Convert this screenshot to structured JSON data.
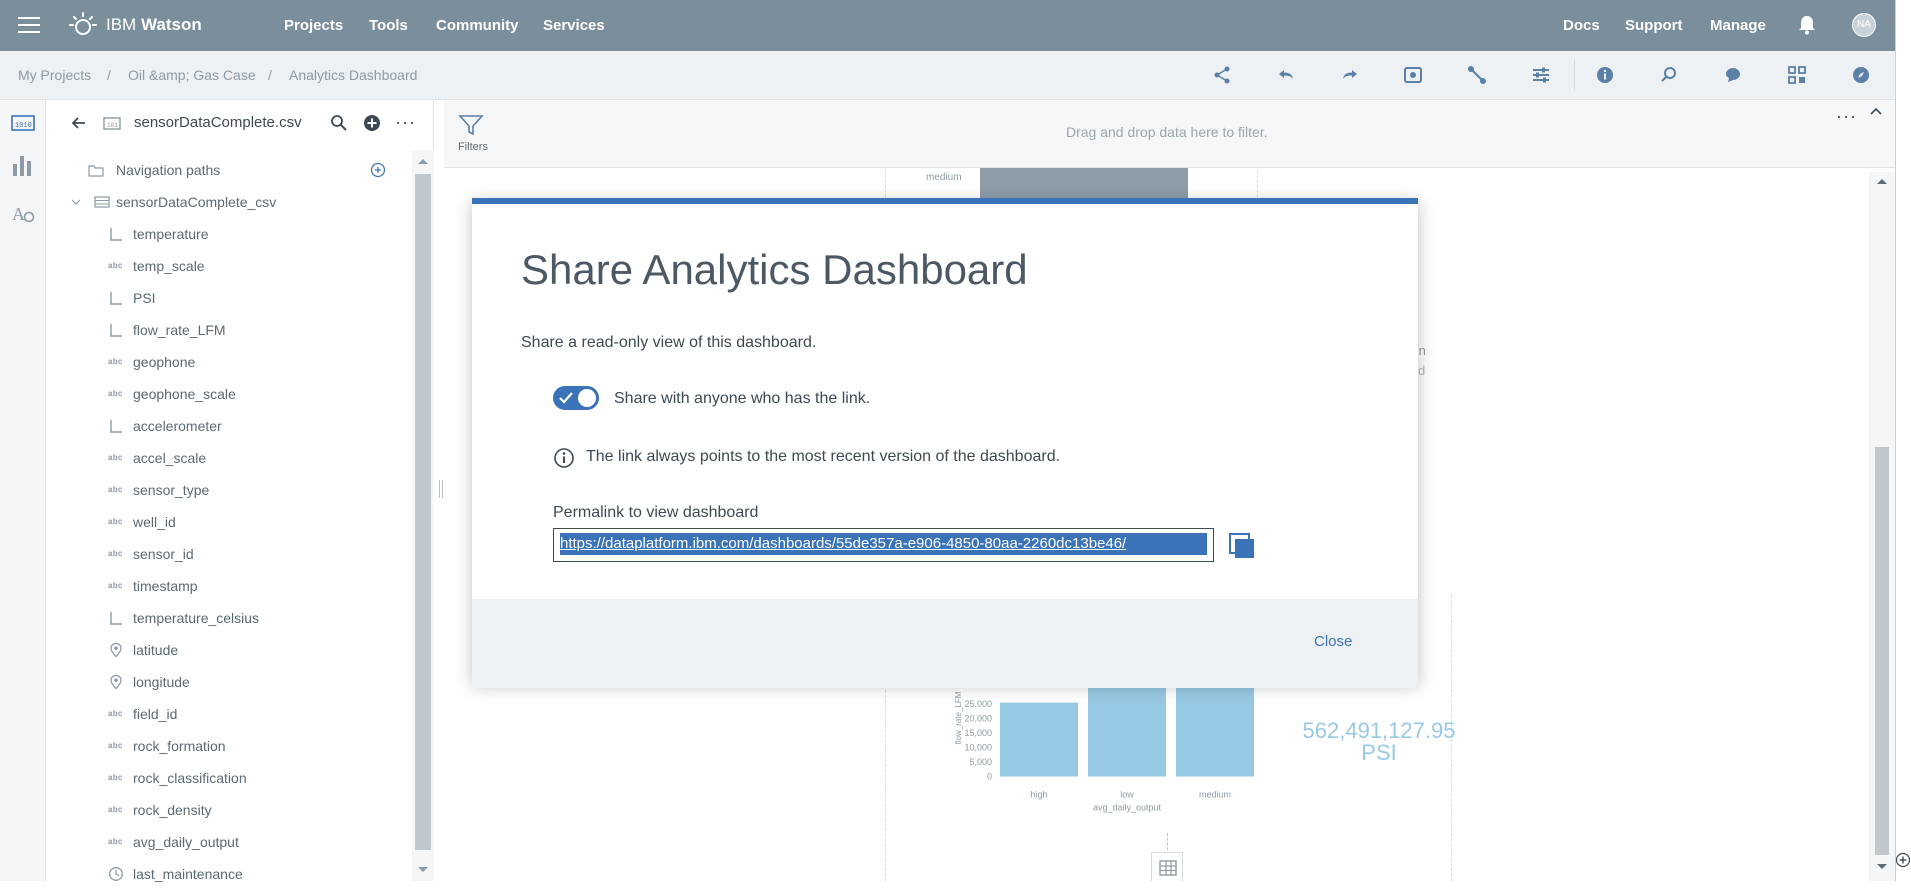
{
  "topbar": {
    "brand_prefix": "IBM",
    "brand_name": "Watson",
    "nav": [
      "Projects",
      "Tools",
      "Community",
      "Services"
    ],
    "right": [
      "Docs",
      "Support",
      "Manage"
    ],
    "avatar": "NA"
  },
  "breadcrumb": [
    "My Projects",
    "Oil &amp; Gas Case",
    "Analytics Dashboard"
  ],
  "panel": {
    "title": "sensorDataComplete.csv",
    "nav_paths": "Navigation paths",
    "table": "sensorDataComplete_csv",
    "fields": [
      {
        "name": "temperature",
        "type": "measure"
      },
      {
        "name": "temp_scale",
        "type": "abc"
      },
      {
        "name": "PSI",
        "type": "measure"
      },
      {
        "name": "flow_rate_LFM",
        "type": "measure"
      },
      {
        "name": "geophone",
        "type": "abc"
      },
      {
        "name": "geophone_scale",
        "type": "abc"
      },
      {
        "name": "accelerometer",
        "type": "measure"
      },
      {
        "name": "accel_scale",
        "type": "abc"
      },
      {
        "name": "sensor_type",
        "type": "abc"
      },
      {
        "name": "well_id",
        "type": "abc"
      },
      {
        "name": "sensor_id",
        "type": "abc"
      },
      {
        "name": "timestamp",
        "type": "abc"
      },
      {
        "name": "temperature_celsius",
        "type": "measure"
      },
      {
        "name": "latitude",
        "type": "geo"
      },
      {
        "name": "longitude",
        "type": "geo"
      },
      {
        "name": "field_id",
        "type": "abc"
      },
      {
        "name": "rock_formation",
        "type": "abc"
      },
      {
        "name": "rock_classification",
        "type": "abc"
      },
      {
        "name": "rock_density",
        "type": "abc"
      },
      {
        "name": "avg_daily_output",
        "type": "abc"
      },
      {
        "name": "last_maintenance",
        "type": "time"
      }
    ]
  },
  "canvas": {
    "filters_label": "Filters",
    "drop_hint": "Drag and drop data here to filter.",
    "bg_label_medium": "medium",
    "bg_text_1": "ition",
    "bg_text_2": "d",
    "kpi_value": "562,491,127.95",
    "kpi_unit": "PSI"
  },
  "chart_data": {
    "type": "bar",
    "categories": [
      "high",
      "low",
      "medium"
    ],
    "xlabel": "avg_daily_output",
    "ylabel": "flow_rate_LFM",
    "yticks": [
      "25,000",
      "20,000",
      "15,000",
      "10,000",
      "5,000",
      "0"
    ],
    "values": [
      25500,
      31000,
      31000
    ],
    "ylim": [
      0,
      25000
    ]
  },
  "modal": {
    "title": "Share Analytics Dashboard",
    "subtitle": "Share a read-only view of this dashboard.",
    "toggle_label": "Share with anyone who has the link.",
    "toggle_on": true,
    "info": "The link always points to the most recent version of the dashboard.",
    "permalink_label": "Permalink to view dashboard",
    "permalink": "https://dataplatform.ibm.com/dashboards/55de357a-e906-4850-80aa-2260dc13be46/",
    "close_label": "Close",
    "accent": "#3b73b9"
  }
}
